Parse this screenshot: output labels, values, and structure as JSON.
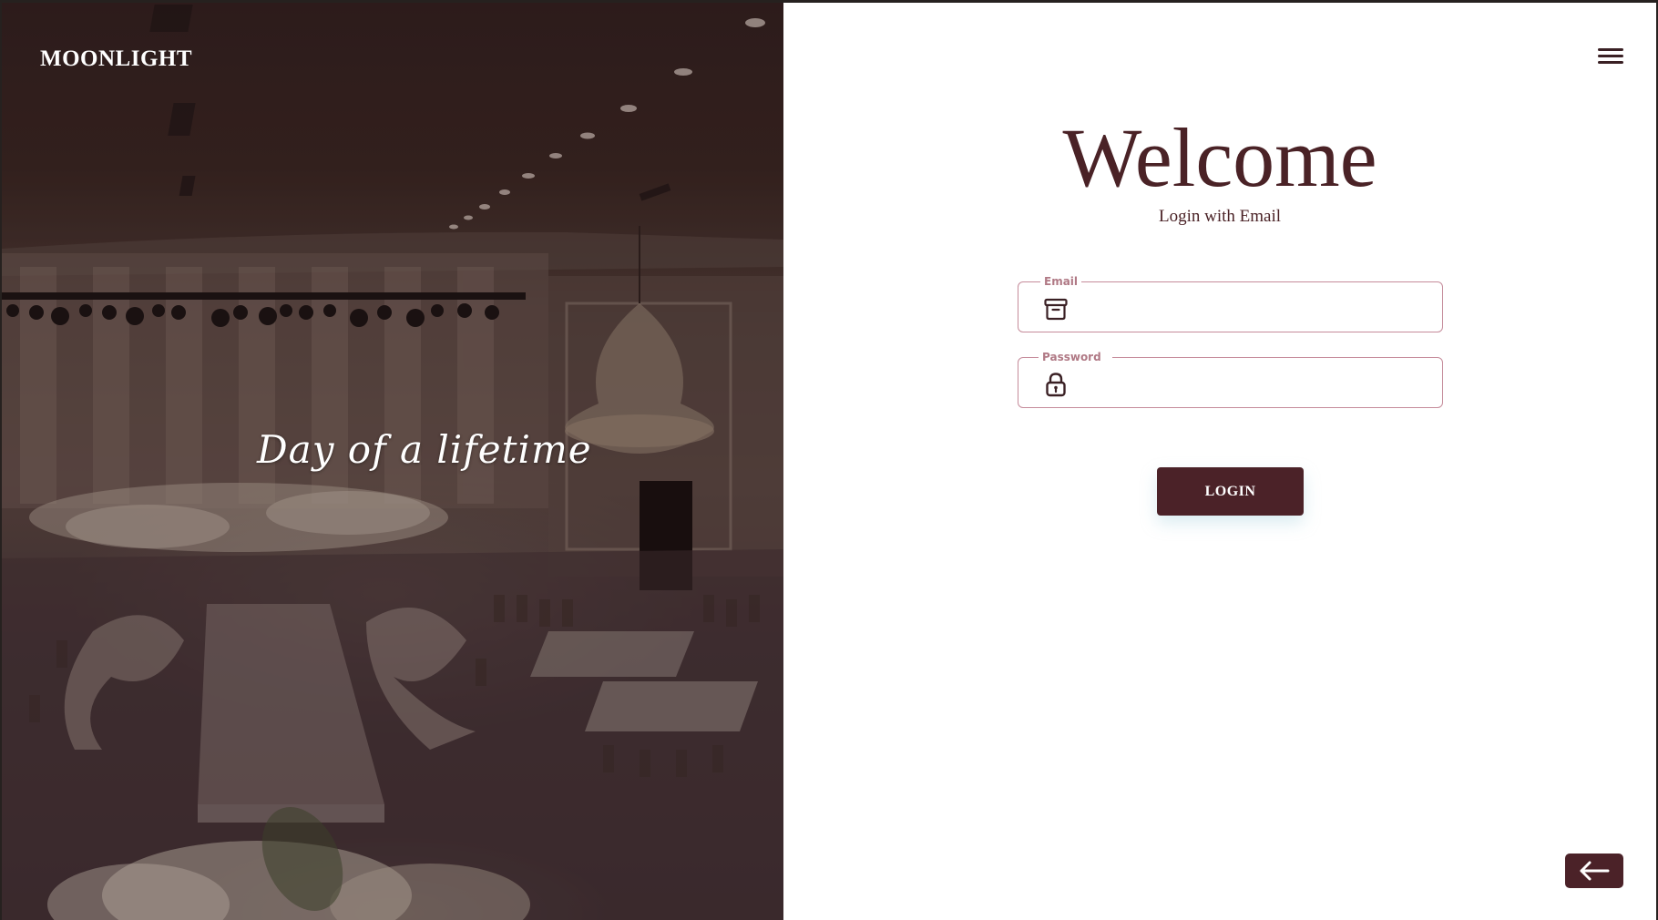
{
  "hero": {
    "brand": "MOONLIGHT",
    "tagline": "Day of a lifetime"
  },
  "header": {
    "menu_icon": "hamburger-menu-icon"
  },
  "login": {
    "title": "Welcome",
    "subtitle": "Login with Email",
    "email": {
      "label": "Email",
      "value": "",
      "icon": "archive-box-icon"
    },
    "password": {
      "label": "Password",
      "value": "",
      "icon": "lock-icon"
    },
    "submit_label": "LOGIN"
  },
  "footer": {
    "back_icon": "arrow-left-icon"
  },
  "colors": {
    "brand_dark": "#4b2228",
    "title_text": "#4a2226",
    "field_border": "#c58b9a",
    "field_label": "#b07985"
  }
}
